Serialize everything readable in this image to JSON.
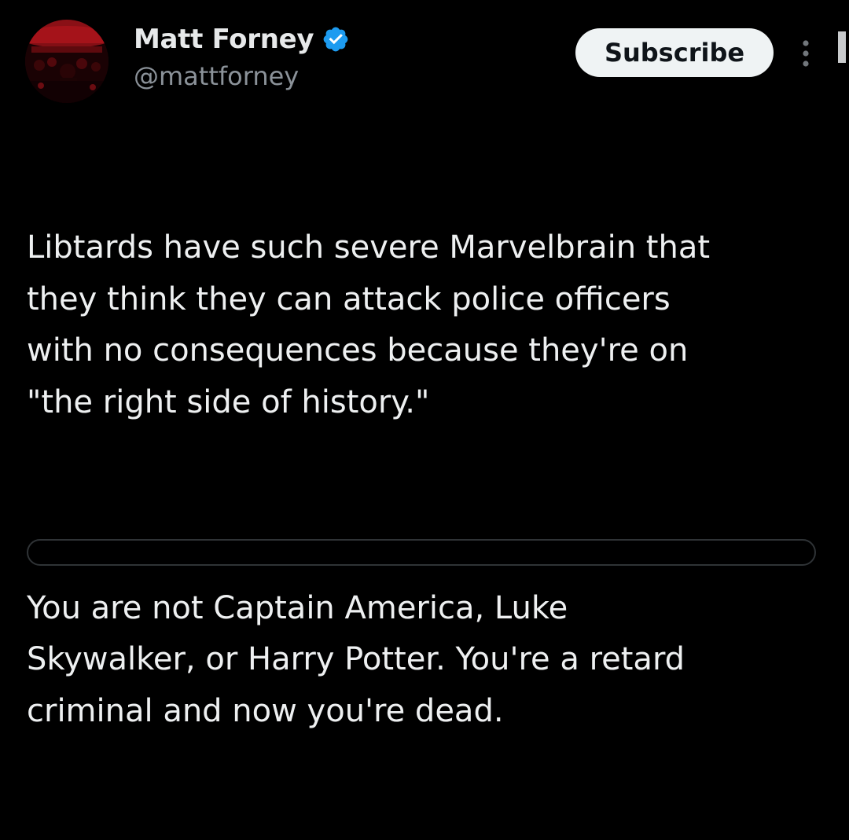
{
  "author": {
    "display_name": "Matt Forney",
    "handle": "@mattforney",
    "verified": true,
    "verified_badge_color": "#1d9bf0"
  },
  "actions": {
    "subscribe_label": "Subscribe",
    "more_icon": "more-vertical-icon"
  },
  "tweet": {
    "paragraphs": [
      "Libtards have such severe Marvelbrain that\nthey think they can attack police officers\nwith no consequences because they're on\n\"the right side of history.\"",
      "You are not Captain America, Luke\nSkywalker, or Harry Potter. You're a retard\ncriminal and now you're dead."
    ]
  },
  "colors": {
    "background": "#000000",
    "text": "#e7e9ea",
    "secondary_text": "#8b9299",
    "button_bg": "#eff3f4",
    "button_text": "#0f1419"
  }
}
